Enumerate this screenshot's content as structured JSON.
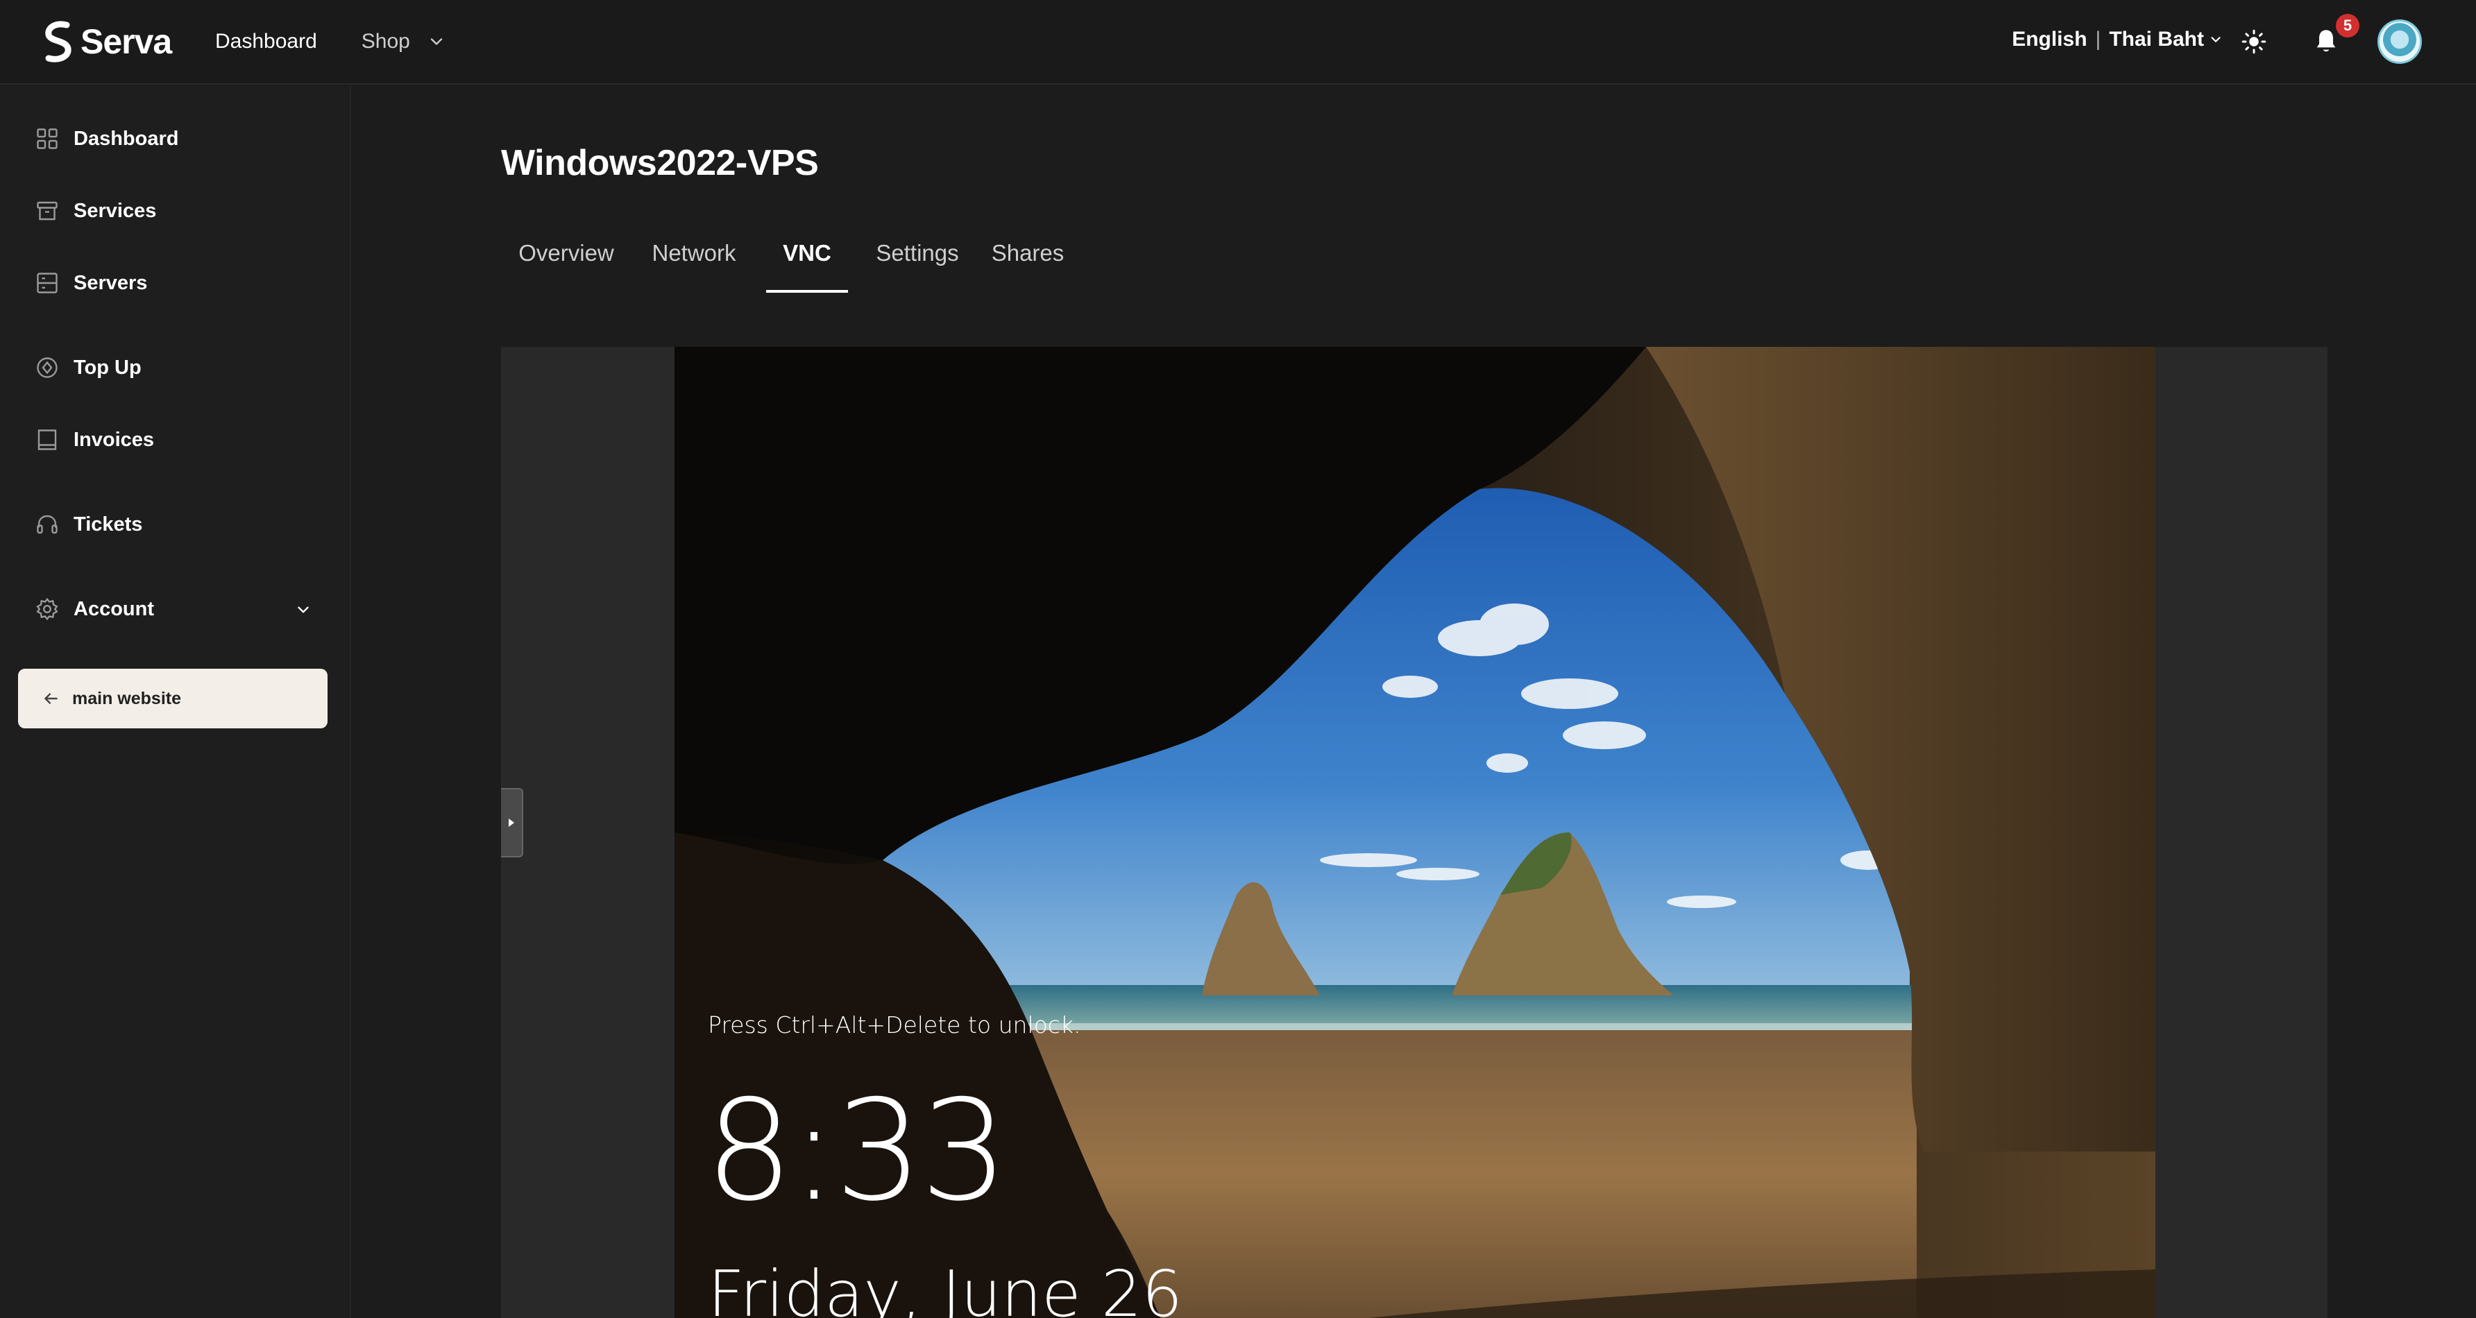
{
  "brand": {
    "name": "Serva"
  },
  "topnav": {
    "dashboard": "Dashboard",
    "shop": "Shop"
  },
  "topright": {
    "language": "English",
    "currency": "Thai Baht",
    "notifications_count": "5"
  },
  "sidebar": {
    "items": [
      {
        "label": "Dashboard",
        "icon": "grid-icon"
      },
      {
        "label": "Services",
        "icon": "archive-box-icon"
      },
      {
        "label": "Servers",
        "icon": "server-icon"
      },
      {
        "label": "Top Up",
        "icon": "coin-icon"
      },
      {
        "label": "Invoices",
        "icon": "receipt-icon"
      },
      {
        "label": "Tickets",
        "icon": "headset-icon"
      },
      {
        "label": "Account",
        "icon": "gear-icon"
      }
    ],
    "back_button": "main website"
  },
  "page": {
    "title": "Windows2022-VPS",
    "tabs": [
      "Overview",
      "Network",
      "VNC",
      "Settings",
      "Shares"
    ],
    "active_tab": "VNC"
  },
  "vnc": {
    "lock_message": "Press Ctrl+Alt+Delete to unlock.",
    "time": "8:33",
    "date": "Friday, June 26"
  },
  "colors": {
    "background": "#1c1c1c",
    "sidebar": "#1e1e1e",
    "accent_button": "#f3eee7",
    "badge": "#d32f2f"
  }
}
